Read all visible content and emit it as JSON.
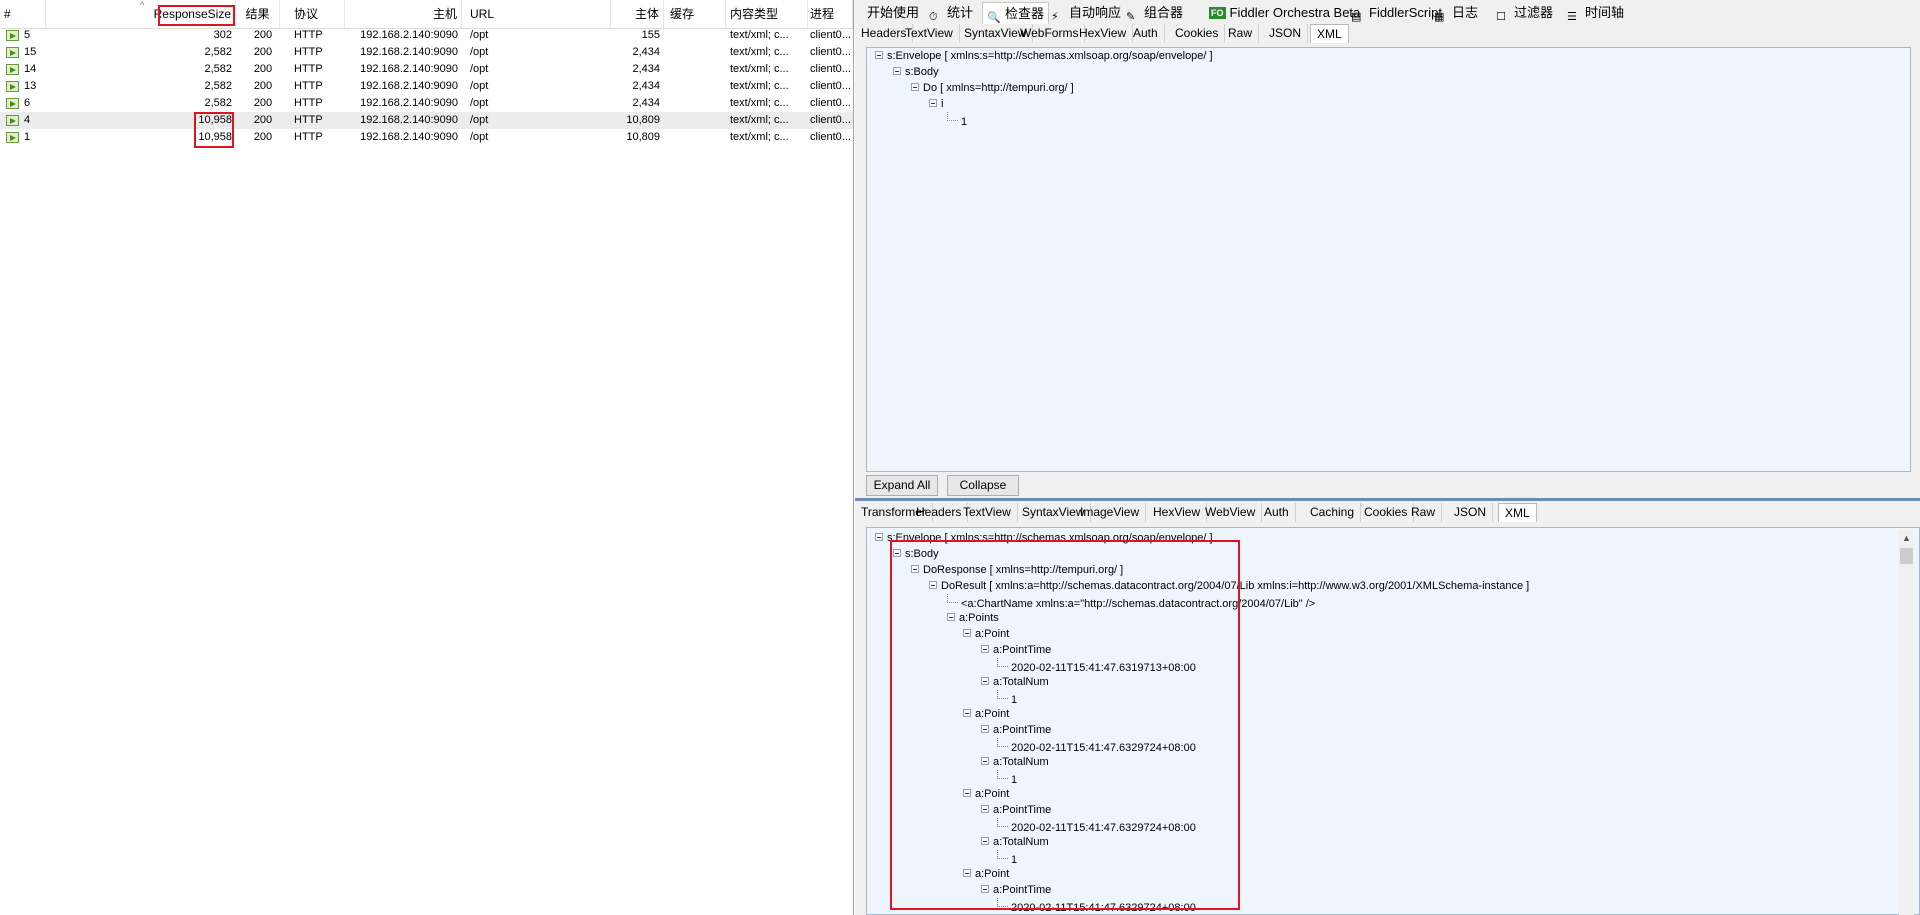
{
  "sessions": {
    "headers": {
      "num": "#",
      "response_size": "ResponseSize",
      "result": "结果",
      "protocol": "协议",
      "host": "主机",
      "url": "URL",
      "body": "主体",
      "caching": "缓存",
      "content_type": "内容类型",
      "process": "进程"
    },
    "rows": [
      {
        "num": "5",
        "size": "302",
        "result": "200",
        "protocol": "HTTP",
        "host": "192.168.2.140:9090",
        "url": "/opt",
        "body": "155",
        "ctype": "text/xml; c...",
        "process": "client0..."
      },
      {
        "num": "15",
        "size": "2,582",
        "result": "200",
        "protocol": "HTTP",
        "host": "192.168.2.140:9090",
        "url": "/opt",
        "body": "2,434",
        "ctype": "text/xml; c...",
        "process": "client0..."
      },
      {
        "num": "14",
        "size": "2,582",
        "result": "200",
        "protocol": "HTTP",
        "host": "192.168.2.140:9090",
        "url": "/opt",
        "body": "2,434",
        "ctype": "text/xml; c...",
        "process": "client0..."
      },
      {
        "num": "13",
        "size": "2,582",
        "result": "200",
        "protocol": "HTTP",
        "host": "192.168.2.140:9090",
        "url": "/opt",
        "body": "2,434",
        "ctype": "text/xml; c...",
        "process": "client0..."
      },
      {
        "num": "6",
        "size": "2,582",
        "result": "200",
        "protocol": "HTTP",
        "host": "192.168.2.140:9090",
        "url": "/opt",
        "body": "2,434",
        "ctype": "text/xml; c...",
        "process": "client0..."
      },
      {
        "num": "4",
        "size": "10,958",
        "result": "200",
        "protocol": "HTTP",
        "host": "192.168.2.140:9090",
        "url": "/opt",
        "body": "10,809",
        "ctype": "text/xml; c...",
        "process": "client0..."
      },
      {
        "num": "1",
        "size": "10,958",
        "result": "200",
        "protocol": "HTTP",
        "host": "192.168.2.140:9090",
        "url": "/opt",
        "body": "10,809",
        "ctype": "text/xml; c...",
        "process": "client0..."
      }
    ]
  },
  "main_tabs": [
    "开始使用",
    "统计",
    "检查器",
    "自动响应",
    "组合器",
    "Fiddler Orchestra Beta",
    "FiddlerScript",
    "日志",
    "过滤器",
    "时间轴"
  ],
  "request_tabs": [
    "Headers",
    "TextView",
    "SyntaxView",
    "WebForms",
    "HexView",
    "Auth",
    "Cookies",
    "Raw",
    "JSON",
    "XML"
  ],
  "request_tree": [
    "s:Envelope [ xmlns:s=http://schemas.xmlsoap.org/soap/envelope/ ]",
    "s:Body",
    "Do [ xmlns=http://tempuri.org/ ]",
    "i",
    "1"
  ],
  "buttons": {
    "expand_all": "Expand All",
    "collapse": "Collapse"
  },
  "response_tabs": [
    "Transformer",
    "Headers",
    "TextView",
    "SyntaxView",
    "ImageView",
    "HexView",
    "WebView",
    "Auth",
    "Caching",
    "Cookies",
    "Raw",
    "JSON",
    "XML"
  ],
  "response_tree": [
    "s:Envelope [ xmlns:s=http://schemas.xmlsoap.org/soap/envelope/ ]",
    "s:Body",
    "DoResponse [ xmlns=http://tempuri.org/ ]",
    "DoResult [ xmlns:a=http://schemas.datacontract.org/2004/07/Lib xmlns:i=http://www.w3.org/2001/XMLSchema-instance ]",
    "<a:ChartName xmlns:a=\"http://schemas.datacontract.org/2004/07/Lib\" />",
    "a:Points",
    "a:Point",
    "a:PointTime",
    "2020-02-11T15:41:47.6319713+08:00",
    "a:TotalNum",
    "1",
    "a:Point",
    "a:PointTime",
    "2020-02-11T15:41:47.6329724+08:00",
    "a:TotalNum",
    "1",
    "a:Point",
    "a:PointTime",
    "2020-02-11T15:41:47.6329724+08:00",
    "a:TotalNum",
    "1",
    "a:Point",
    "a:PointTime",
    "2020-02-11T15:41:47.6329724+08:00"
  ],
  "colors": {
    "highlight_red": "#e0141e",
    "tree_bg": "#eef5fd",
    "splitter": "#6b8bb0"
  }
}
